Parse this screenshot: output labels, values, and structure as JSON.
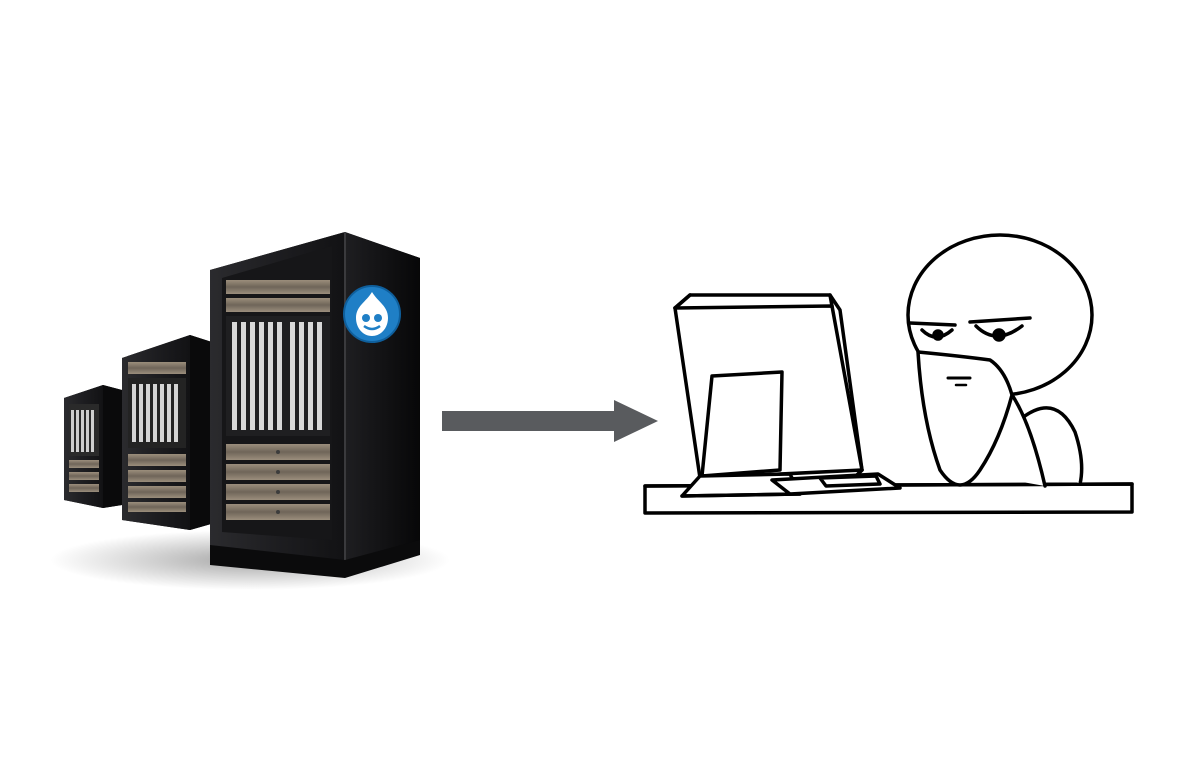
{
  "scene": {
    "background_color": "#ffffff",
    "servers": {
      "count": 3,
      "cabinet_color": "#1b1b1d",
      "cabinet_side_color": "#0c0c0d",
      "panel_color": "#8a7f70",
      "badge": {
        "icon": "drupal-drop-icon",
        "color": "#1f7fc6"
      }
    },
    "arrow": {
      "direction": "right",
      "color": "#595b5e"
    },
    "person": {
      "style": "rage-comic line drawing",
      "line_color": "#000000",
      "fill_color": "#ffffff",
      "expression": "skeptical",
      "has_beard": true
    },
    "computer": {
      "items": [
        "monitor",
        "keyboard",
        "desk"
      ]
    }
  }
}
